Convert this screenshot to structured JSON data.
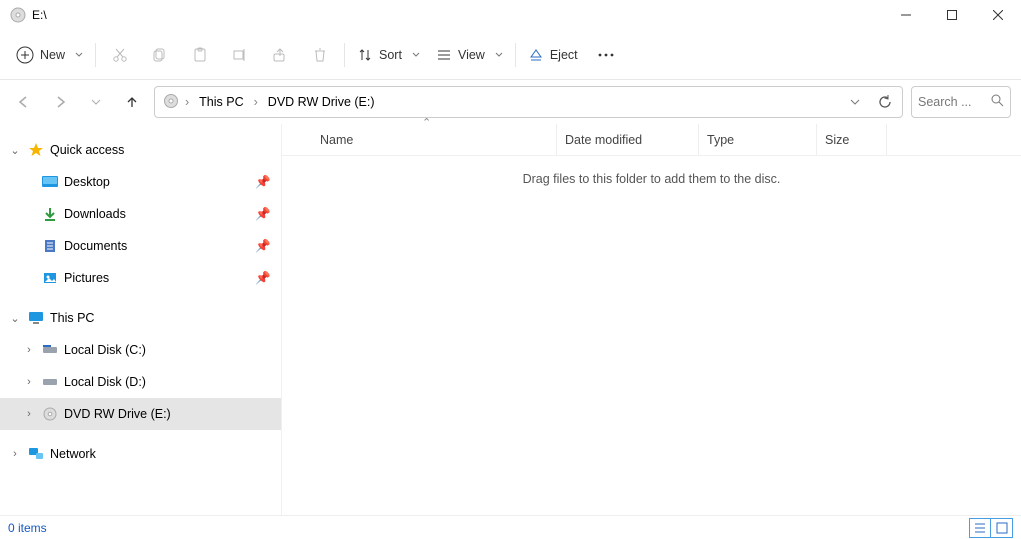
{
  "window": {
    "title": "E:\\"
  },
  "toolbar": {
    "new_label": "New",
    "sort_label": "Sort",
    "view_label": "View",
    "eject_label": "Eject"
  },
  "address": {
    "root": "This PC",
    "leaf": "DVD RW Drive (E:)"
  },
  "search": {
    "placeholder": "Search ..."
  },
  "sidebar": {
    "quick_access": "Quick access",
    "desktop": "Desktop",
    "downloads": "Downloads",
    "documents": "Documents",
    "pictures": "Pictures",
    "this_pc": "This PC",
    "local_c": "Local Disk (C:)",
    "local_d": "Local Disk (D:)",
    "dvd_e": "DVD RW Drive (E:)",
    "network": "Network"
  },
  "columns": {
    "name": "Name",
    "date": "Date modified",
    "type": "Type",
    "size": "Size"
  },
  "empty_message": "Drag files to this folder to add them to the disc.",
  "status": {
    "count_text": "0 items"
  }
}
